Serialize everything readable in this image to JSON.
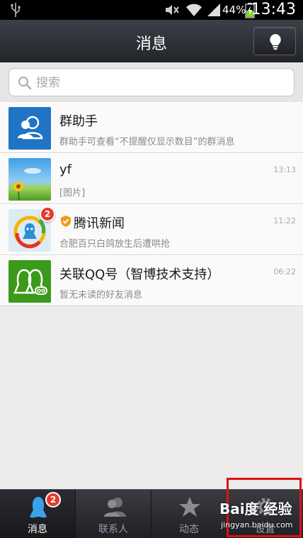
{
  "status_bar": {
    "battery_percent": "44%",
    "time": "13:43",
    "icons": [
      "usb-icon",
      "mute-icon",
      "wifi-icon",
      "signal-icon",
      "battery-icon"
    ]
  },
  "header": {
    "title": "消息",
    "action_icon": "lightbulb-icon"
  },
  "search": {
    "placeholder": "搜索",
    "value": ""
  },
  "conversations": [
    {
      "name": "群助手",
      "preview": "群助手可查看“不提醒仅显示数目”的群消息",
      "time": "",
      "badge": "",
      "avatar": "group-assistant-avatar"
    },
    {
      "name": "yf",
      "preview": "[图片]",
      "time": "13:13",
      "badge": "",
      "avatar": "sunflower-sky-avatar"
    },
    {
      "name": "腾讯新闻",
      "preview": "合肥百只白鸽放生后遭哄抢",
      "time": "11:22",
      "badge": "2",
      "avatar": "tencent-news-avatar",
      "verified": true
    },
    {
      "name": "关联QQ号（智博技术支持）",
      "preview": "暂无未读的好友消息",
      "time": "06:22",
      "badge": "",
      "avatar": "linked-qq-avatar"
    }
  ],
  "tabs": [
    {
      "label": "消息",
      "icon": "penguin-icon",
      "badge": "2",
      "active": true
    },
    {
      "label": "联系人",
      "icon": "contacts-icon",
      "badge": "",
      "active": false
    },
    {
      "label": "动态",
      "icon": "star-icon",
      "badge": "",
      "active": false
    },
    {
      "label": "设置",
      "icon": "gear-icon",
      "badge": "",
      "active": false
    }
  ],
  "watermark": {
    "logo": "Bai度 经验",
    "url": "jingyan.baidu.com"
  },
  "colors": {
    "title_bar": "#2e3036",
    "badge": "#e43b2f",
    "highlight": "#e01010",
    "assistant_blue": "#1f74c4",
    "qq_green": "#3b9a1b"
  }
}
